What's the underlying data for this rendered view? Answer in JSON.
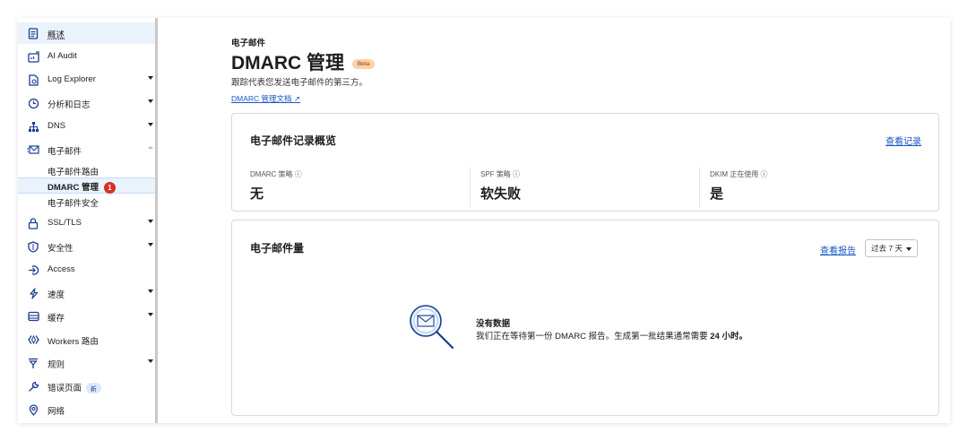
{
  "sidebar": {
    "items": [
      {
        "label": "概述",
        "icon": "document-icon",
        "caret": "none"
      },
      {
        "label": "AI Audit",
        "icon": "ai-audit-icon",
        "caret": "none"
      },
      {
        "label": "Log Explorer",
        "icon": "log-explorer-icon",
        "caret": "down"
      },
      {
        "label": "分析和日志",
        "icon": "clock-icon",
        "caret": "down"
      },
      {
        "label": "DNS",
        "icon": "network-tree-icon",
        "caret": "down"
      },
      {
        "label": "电子邮件",
        "icon": "email-icon",
        "caret": "up"
      },
      {
        "label": "SSL/TLS",
        "icon": "lock-icon",
        "caret": "down"
      },
      {
        "label": "安全性",
        "icon": "shield-icon",
        "caret": "down"
      },
      {
        "label": "Access",
        "icon": "access-icon",
        "caret": "none"
      },
      {
        "label": "速度",
        "icon": "lightning-icon",
        "caret": "down"
      },
      {
        "label": "缓存",
        "icon": "cache-icon",
        "caret": "down"
      },
      {
        "label": "Workers 路由",
        "icon": "workers-icon",
        "caret": "none"
      },
      {
        "label": "规则",
        "icon": "rules-icon",
        "caret": "down"
      },
      {
        "label": "错误页面",
        "icon": "wrench-icon",
        "caret": "none",
        "pill": "新"
      },
      {
        "label": "网络",
        "icon": "location-pin-icon",
        "caret": "none"
      }
    ],
    "email_sub": [
      {
        "label": "电子邮件路由"
      },
      {
        "label": "DMARC 管理",
        "badge": "1"
      },
      {
        "label": "电子邮件安全"
      }
    ]
  },
  "header": {
    "eyebrow": "电子邮件",
    "title": "DMARC 管理",
    "beta": "Beta",
    "description": "跟踪代表您发送电子邮件的第三方。",
    "doc_link": "DMARC 管理文档 ↗"
  },
  "overview": {
    "title": "电子邮件记录概览",
    "link": "查看记录",
    "stats": [
      {
        "label": "DMARC 策略 ⓘ",
        "value": "无"
      },
      {
        "label": "SPF 策略 ⓘ",
        "value": "软失败"
      },
      {
        "label": "DKIM 正在使用 ⓘ",
        "value": "是"
      }
    ]
  },
  "volume": {
    "title": "电子邮件量",
    "link": "查看报告",
    "range": "过去 7 天",
    "empty_title": "没有数据",
    "empty_text_pre": "我们正在等待第一份 DMARC 报告。生成第一批结果通常需要 ",
    "empty_text_bold": "24 小时。"
  },
  "colors": {
    "accent": "#1a56c4",
    "icon": "#1a3d8f",
    "beta_bg": "#fbd1a8",
    "badge_red": "#d93025"
  }
}
